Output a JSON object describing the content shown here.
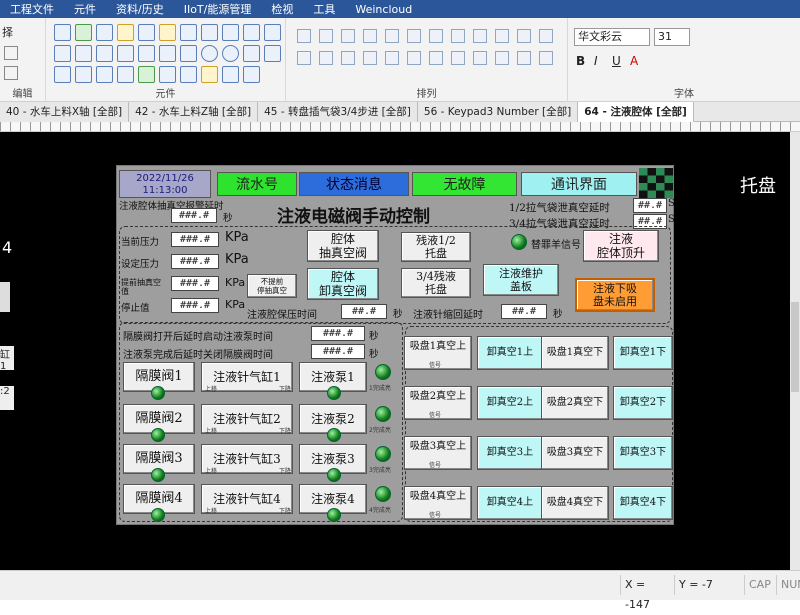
{
  "menu": [
    "工程文件",
    "元件",
    "资料/历史",
    "IIoT/能源管理",
    "检视",
    "工具",
    "Weincloud"
  ],
  "ribbon": {
    "left_group_label": "编辑",
    "left_partial": "择",
    "components_label": "元件",
    "arrange_label": "排列",
    "font_label": "字体",
    "font_name": "华文彩云",
    "font_size": "31"
  },
  "tabs": [
    "40 - 水车上料X轴 [全部]",
    "42 - 水车上料Z轴 [全部]",
    "45 - 转盘插气袋3/4步进 [全部]",
    "56 - Keypad3 Number [全部]",
    "64 - 注液腔体 [全部]"
  ],
  "offcanvas": {
    "right_text": "托盘",
    "left_digit": "4",
    "left_a": "缸1",
    "left_b": ":2"
  },
  "panel": {
    "date": "2022/11/26",
    "time": "11:13:00",
    "headers": [
      "流水号",
      "状态消息",
      "无故障",
      "通讯界面"
    ],
    "title": "注液电磁阀手动控制",
    "vacuum_delay_label": "注液腔体抽真空报警延时",
    "unit_s": "秒",
    "num_placeholder": "###.#",
    "num_placeholder2": "##.#",
    "rows": [
      {
        "label": "当前压力",
        "value": "###.#",
        "unit": "KPa"
      },
      {
        "label": "设定压力",
        "value": "###.#",
        "unit": "KPa"
      },
      {
        "label": "提前抽真空值",
        "value": "###.#",
        "unit": "KPa"
      },
      {
        "label": "停止值",
        "value": "###.#",
        "unit": "KPa"
      }
    ],
    "no_early": "不提前\n停抽真空",
    "cavity_vacuum": "腔体\n抽真空阀",
    "cavity_release": "腔体\n卸真空阀",
    "residue_12": "残液1/2\n托盘",
    "residue_34": "3/4残液\n托盘",
    "replace_signal": "替罪羊信号",
    "cavity_lift": "注液\n腔体顶升",
    "maintenance_cover": "注液维护\n盖板",
    "tray_no_suck": "注液下吸\n盘未启用",
    "delay_12": "1/2拉气袋泄真空延时",
    "delay_34": "3/4拉气袋泄真空延时",
    "hold_pressure": "注液腔保压时间",
    "needle_return": "注液针缩回延时",
    "pump_start": "隔膜阀打开后延时启动注液泵时间",
    "pump_close": "注液泵完成后延时关闭隔膜阀时间",
    "diaphragm": [
      "隔膜阀1",
      "隔膜阀2",
      "隔膜阀3",
      "隔膜阀4"
    ],
    "needle": [
      "注液针气缸1",
      "注液针气缸2",
      "注液针气缸3",
      "注液针气缸4"
    ],
    "pump": [
      "注液泵1",
      "注液泵2",
      "注液泵3",
      "注液泵4"
    ],
    "pump_done": [
      "1完成亮",
      "2完成亮",
      "3完成亮",
      "4完成亮"
    ],
    "up": "上移",
    "down": "下降",
    "suction_rows": [
      [
        "吸盘1真空上",
        "卸真空1上",
        "吸盘1真空下",
        "卸真空1下"
      ],
      [
        "吸盘2真空上",
        "卸真空2上",
        "吸盘2真空下",
        "卸真空2下"
      ],
      [
        "吸盘3真空上",
        "卸真空3上",
        "吸盘3真空下",
        "卸真空3下"
      ],
      [
        "吸盘4真空上",
        "卸真空4上",
        "吸盘4真空下",
        "卸真空4下"
      ]
    ],
    "signal": "信号"
  },
  "status": {
    "x": "X = -147",
    "y": "Y = -7",
    "cap": "CAP",
    "num": "NUM"
  },
  "colors": {
    "header_green": "#2ee32e",
    "header_blue": "#2d6ddb",
    "header_lime": "#33e633",
    "header_teal": "#9ff0f0"
  }
}
